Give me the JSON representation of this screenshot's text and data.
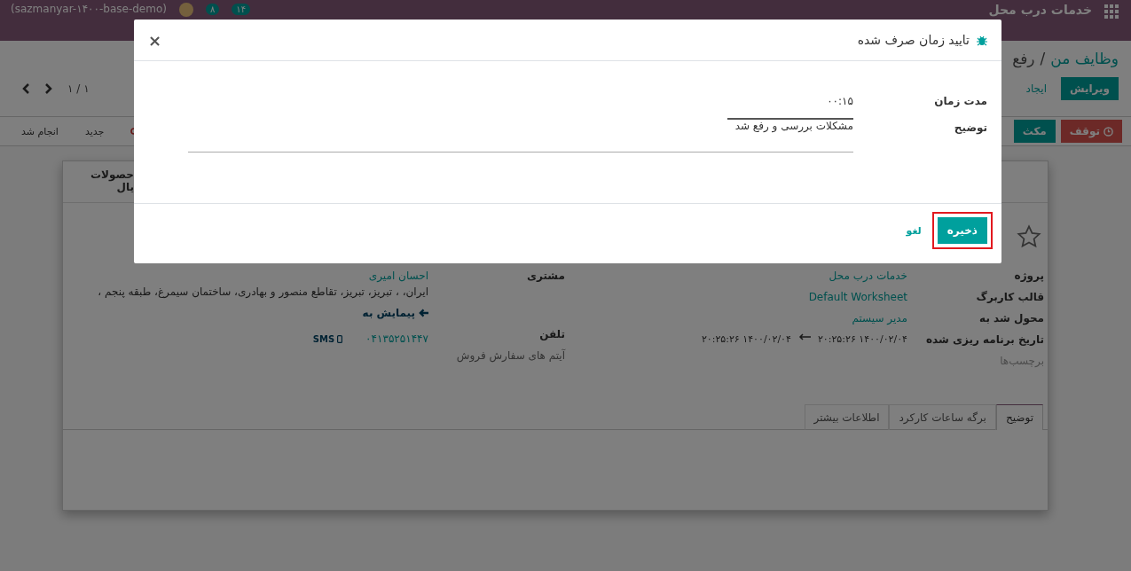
{
  "navbar": {
    "app_title": "خدمات درب محل",
    "counters": [
      {
        "count": "۱۴"
      },
      {
        "count": "۸"
      }
    ],
    "database": "(sazmanyar-۱۴۰۰-base-demo)"
  },
  "breadcrumb": {
    "items": [
      "وظایف من",
      "رفع"
    ],
    "separator": "/"
  },
  "actions": [
    {
      "label": "ویرایش",
      "kind": "primary"
    },
    {
      "label": "ایجاد",
      "kind": "link"
    }
  ],
  "pager": "۱ / ۱",
  "status_buttons": [
    {
      "label": "توقف",
      "kind": "danger"
    },
    {
      "label": "مکث",
      "kind": "primary"
    }
  ],
  "stages": [
    "جدید",
    "انجام شد"
  ],
  "smart_button": {
    "lines": [
      "حصولات",
      "یال"
    ]
  },
  "task": {
    "starred": false,
    "fields": [
      {
        "label": "پروژه",
        "value": "خدمات درب محل"
      },
      {
        "label": "قالب کاربرگ",
        "value": "Default Worksheet"
      },
      {
        "label": "محول شد به",
        "value": "مدیر سیستم"
      },
      {
        "label": "تاریخ برنامه ریزی شده",
        "start": "۱۴۰۰/۰۲/۰۴ ۲۰:۲۵:۲۶",
        "end": "۱۴۰۰/۰۲/۰۴ ۲۰:۲۵:۲۶"
      }
    ],
    "tags_placeholder": "برچسب‌ها",
    "customer": {
      "label": "مشتری",
      "name": "احسان امیری",
      "address": "ایران، ، تبریز، تبریز، تقاطع منصور و بهادری، ساختمان سیمرغ، طبقه پنجم ،",
      "navigate": "پیمایش به"
    },
    "phone": {
      "label": "تلفن",
      "value": "۰۴۱۳۵۲۵۱۴۴۷",
      "sms": "SMS"
    },
    "sale_items_label": "آیتم های سفارش فروش"
  },
  "tabs": [
    {
      "label": "توضیح",
      "selected": true
    },
    {
      "label": "برگه ساعات کارکرد",
      "selected": false
    },
    {
      "label": "اطلاعات بیشتر",
      "selected": false
    }
  ],
  "dialog": {
    "title": "تایید زمان صرف شده",
    "fields": [
      {
        "label": "مدت زمان",
        "value": "۰۰:۱۵",
        "kind": "input"
      },
      {
        "label": "توضیح",
        "value": "مشکلات بررسی و رفع شد",
        "kind": "textarea"
      }
    ],
    "close": "×",
    "save": "ذخیره",
    "save_highlighted": true,
    "cancel": "لغو"
  }
}
